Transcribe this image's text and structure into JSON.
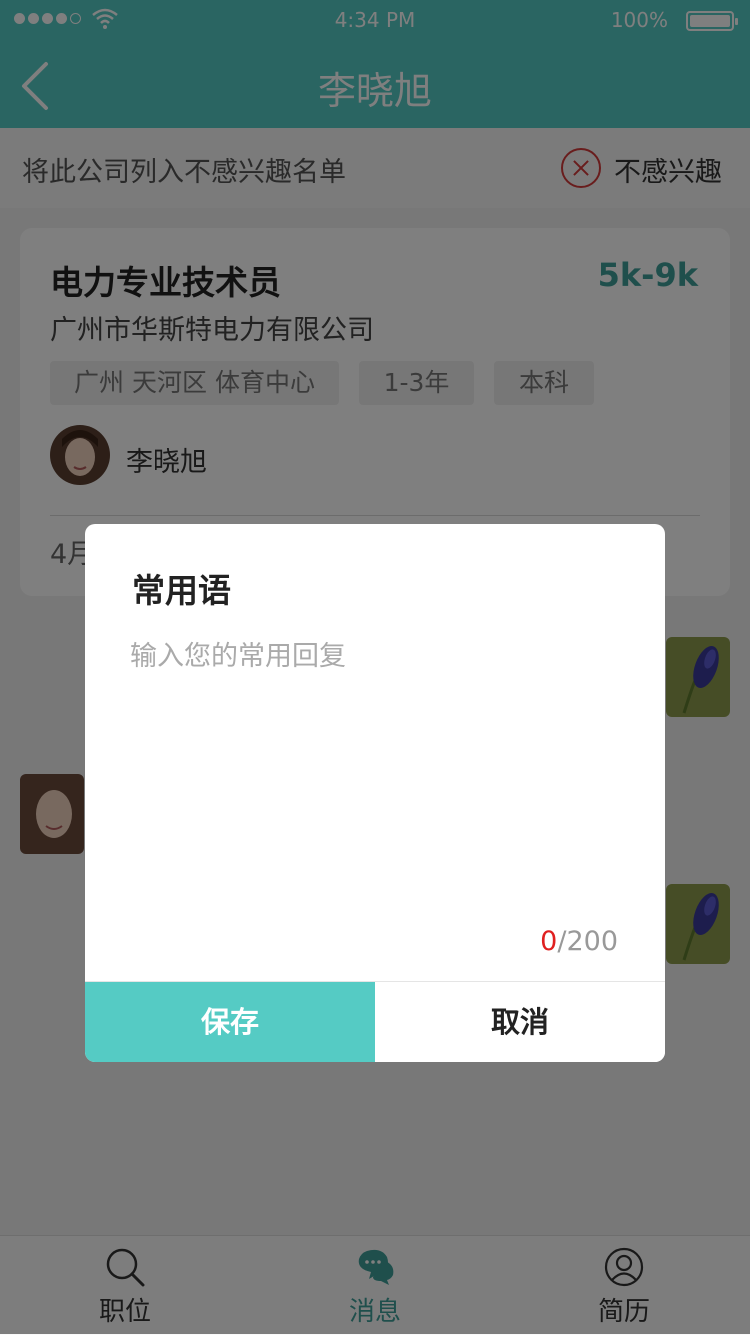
{
  "status_bar": {
    "time": "4:34 PM",
    "battery": "100%"
  },
  "nav": {
    "title": "李晓旭",
    "back_icon": "chevron-left-icon"
  },
  "not_interested": {
    "text": "将此公司列入不感兴趣名单",
    "button_label": "不感兴趣",
    "icon": "close-circle-icon",
    "icon_color": "#d23a3a"
  },
  "job": {
    "title": "电力专业技术员",
    "salary": "5k-9k",
    "company": "广州市华斯特电力有限公司",
    "tags": [
      "广州 天河区 体育中心",
      "1-3年",
      "本科"
    ],
    "recruiter": "李晓旭",
    "date_partial": "4月"
  },
  "dialog": {
    "title": "常用语",
    "placeholder": "输入您的常用回复",
    "value": "",
    "counter_current": "0",
    "counter_max": "/200",
    "save_label": "保存",
    "cancel_label": "取消"
  },
  "tabs": [
    {
      "label": "职位",
      "icon": "search-icon",
      "active": false
    },
    {
      "label": "消息",
      "icon": "chat-bubbles-icon",
      "active": true
    },
    {
      "label": "简历",
      "icon": "user-icon",
      "active": false
    }
  ],
  "colors": {
    "accent": "#55cbc4",
    "salary": "#3f9e99",
    "counter_highlight": "#e02020"
  }
}
